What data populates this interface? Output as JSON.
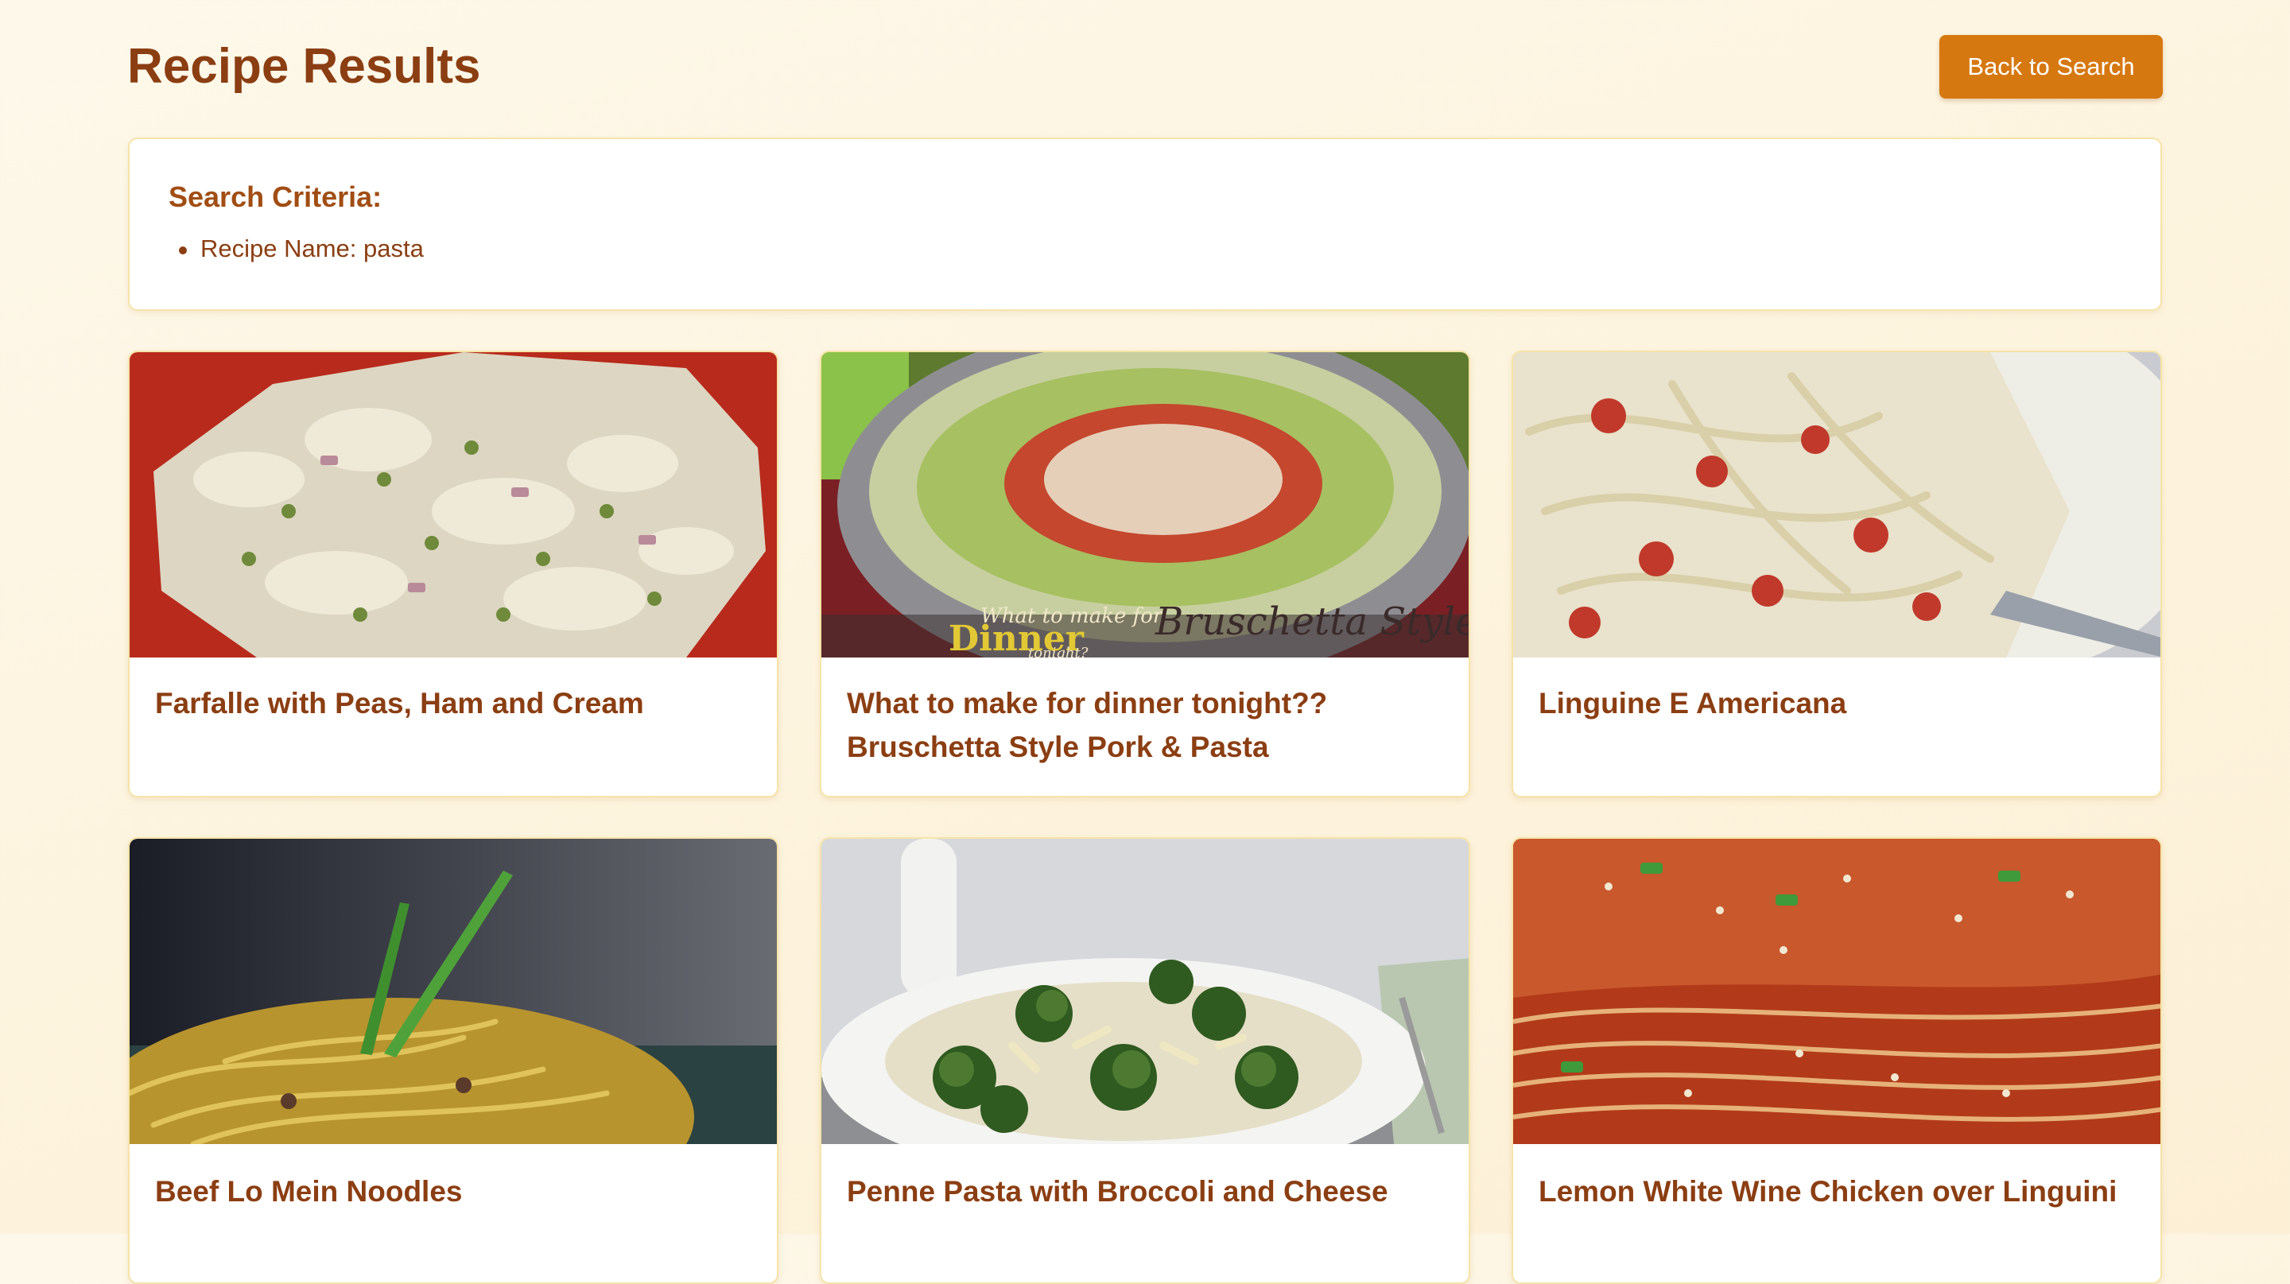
{
  "header": {
    "title": "Recipe Results",
    "back_label": "Back to Search"
  },
  "criteria": {
    "title": "Search Criteria:",
    "items": [
      "Recipe Name: pasta"
    ]
  },
  "recipes": [
    {
      "title": "Farfalle with Peas, Ham and Cream"
    },
    {
      "title": "What to make for dinner tonight?? Bruschetta Style Pork & Pasta"
    },
    {
      "title": "Linguine E Americana"
    },
    {
      "title": "Beef Lo Mein Noodles"
    },
    {
      "title": "Penne Pasta with Broccoli and Cheese"
    },
    {
      "title": "Lemon White Wine Chicken over Linguini"
    }
  ],
  "image_overlay": {
    "line1": "What to make for",
    "line2": "Dinner",
    "line3": "tonight?",
    "line4": "Bruschetta Style"
  },
  "colors": {
    "title": "#8b3e12",
    "accent_button": "#d67810",
    "card_border": "#f6e4a8"
  }
}
